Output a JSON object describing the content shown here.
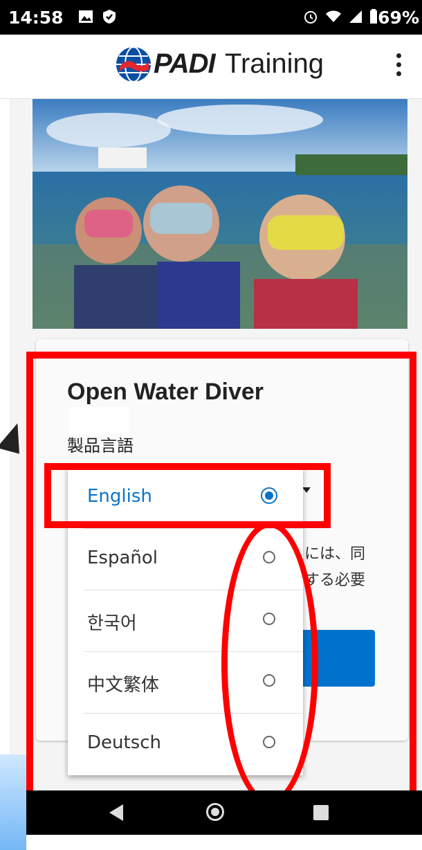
{
  "status_bar": {
    "time": "14:58",
    "battery": "69%"
  },
  "header": {
    "logo_brand": "PADI",
    "logo_suffix": "Training"
  },
  "card": {
    "title": "Open Water Diver",
    "language_label": "製品言語"
  },
  "description_lines": [
    "には、同",
    "する必要"
  ],
  "dropdown": {
    "options": [
      {
        "label": "English",
        "selected": true
      },
      {
        "label": "Español",
        "selected": false
      },
      {
        "label": "한국어",
        "selected": false
      },
      {
        "label": "中文繁体",
        "selected": false
      },
      {
        "label": "Deutsch",
        "selected": false
      }
    ]
  },
  "colors": {
    "accent_blue": "#0b74c7",
    "button_blue": "#0072ce",
    "annotation_red": "#ff0000"
  }
}
